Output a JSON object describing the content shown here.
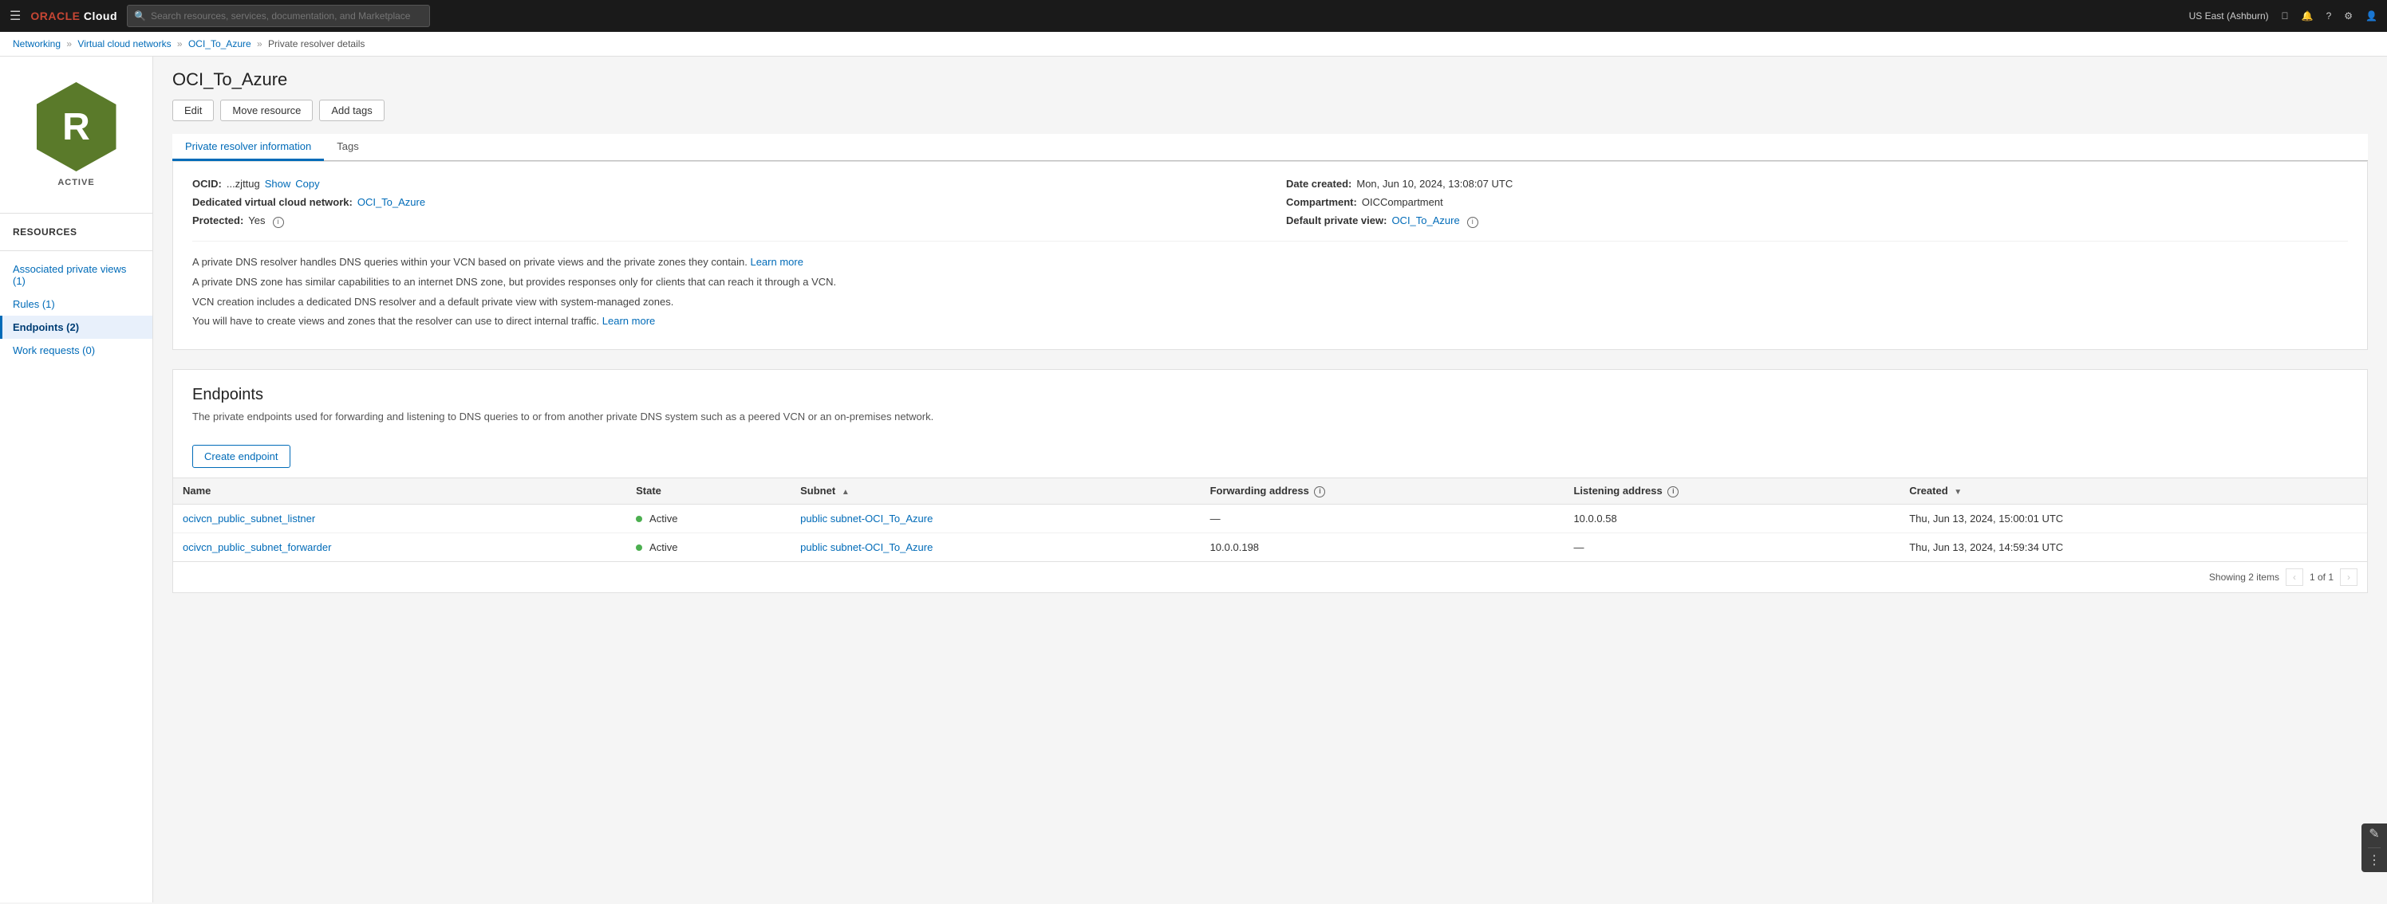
{
  "app": {
    "logo": "Oracle",
    "region": "US East (Ashburn)"
  },
  "search": {
    "placeholder": "Search resources, services, documentation, and Marketplace"
  },
  "breadcrumb": {
    "items": [
      {
        "label": "Networking",
        "href": "#"
      },
      {
        "label": "Virtual cloud networks",
        "href": "#"
      },
      {
        "label": "OCI_To_Azure",
        "href": "#"
      },
      {
        "label": "Private resolver details"
      }
    ]
  },
  "resource": {
    "name": "OCI_To_Azure",
    "initial": "R",
    "status": "ACTIVE"
  },
  "actions": {
    "edit": "Edit",
    "move": "Move resource",
    "tags": "Add tags"
  },
  "tabs": [
    {
      "label": "Private resolver information",
      "active": true
    },
    {
      "label": "Tags",
      "active": false
    }
  ],
  "info": {
    "ocid_prefix": "OCID:",
    "ocid_value": "...zjttug",
    "ocid_show": "Show",
    "ocid_copy": "Copy",
    "vcn_label": "Dedicated virtual cloud network:",
    "vcn_value": "OCI_To_Azure",
    "protected_label": "Protected:",
    "protected_value": "Yes",
    "date_label": "Date created:",
    "date_value": "Mon, Jun 10, 2024, 13:08:07 UTC",
    "compartment_label": "Compartment:",
    "compartment_value": "OICCompartment",
    "default_view_label": "Default private view:",
    "default_view_value": "OCI_To_Azure",
    "description_lines": [
      "A private DNS resolver handles DNS queries within your VCN based on private views and the private zones they contain. Learn more",
      "A private DNS zone has similar capabilities to an internet DNS zone, but provides responses only for clients that can reach it through a VCN.",
      "VCN creation includes a dedicated DNS resolver and a default private view with system-managed zones.",
      "You will have to create views and zones that the resolver can use to direct internal traffic. Learn more"
    ]
  },
  "endpoints": {
    "title": "Endpoints",
    "description": "The private endpoints used for forwarding and listening to DNS queries to or from another private DNS system such as a peered VCN or an on-premises network.",
    "create_btn": "Create endpoint",
    "columns": [
      {
        "label": "Name",
        "sortable": false
      },
      {
        "label": "State",
        "sortable": false
      },
      {
        "label": "Subnet",
        "sortable": true
      },
      {
        "label": "Forwarding address",
        "sortable": false,
        "info": true
      },
      {
        "label": "Listening address",
        "sortable": false,
        "info": true
      },
      {
        "label": "Created",
        "sortable": true
      }
    ],
    "rows": [
      {
        "name": "ocivcn_public_subnet_listner",
        "state": "Active",
        "subnet": "public subnet-OCI_To_Azure",
        "forwarding": "—",
        "listening": "10.0.0.58",
        "created": "Thu, Jun 13, 2024, 15:00:01 UTC"
      },
      {
        "name": "ocivcn_public_subnet_forwarder",
        "state": "Active",
        "subnet": "public subnet-OCI_To_Azure",
        "forwarding": "10.0.0.198",
        "listening": "—",
        "created": "Thu, Jun 13, 2024, 14:59:34 UTC"
      }
    ],
    "footer": {
      "showing": "Showing 2 items",
      "page": "1 of 1"
    }
  },
  "sidebar": {
    "resources_label": "Resources",
    "items": [
      {
        "label": "Associated private views (1)",
        "active": false,
        "id": "associated-private-views"
      },
      {
        "label": "Rules (1)",
        "active": false,
        "id": "rules"
      },
      {
        "label": "Endpoints (2)",
        "active": true,
        "id": "endpoints"
      },
      {
        "label": "Work requests (0)",
        "active": false,
        "id": "work-requests"
      }
    ]
  }
}
